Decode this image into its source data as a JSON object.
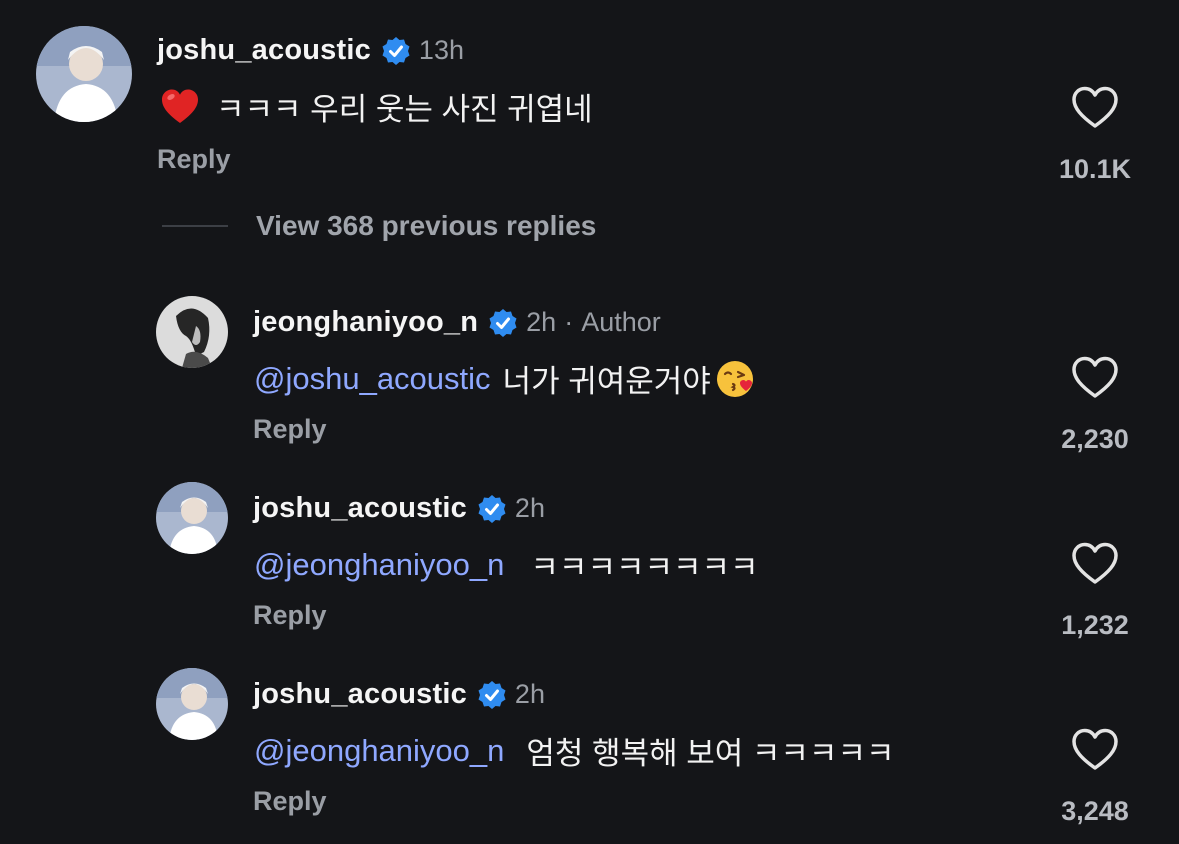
{
  "comment": {
    "username": "joshu_acoustic",
    "time": "13h",
    "text": "ㅋㅋㅋ 우리 웃는 사진 귀엽네",
    "reply_label": "Reply",
    "likes": "10.1K",
    "emoji": "red-heart"
  },
  "view_replies": {
    "label": "View 368 previous replies"
  },
  "replies": [
    {
      "username": "jeonghaniyoo_n",
      "time": "2h",
      "separator": "·",
      "badge": "Author",
      "mention": "@joshu_acoustic",
      "text": "너가 귀여운거야",
      "emoji": "kissing-heart",
      "reply_label": "Reply",
      "likes": "2,230"
    },
    {
      "username": "joshu_acoustic",
      "time": "2h",
      "mention": "@jeonghaniyoo_n",
      "text": "ㅋㅋㅋㅋㅋㅋㅋㅋ",
      "reply_label": "Reply",
      "likes": "1,232"
    },
    {
      "username": "joshu_acoustic",
      "time": "2h",
      "mention": "@jeonghaniyoo_n",
      "text": "엄청 행복해 보여 ㅋㅋㅋㅋㅋ",
      "reply_label": "Reply",
      "likes": "3,248"
    }
  ],
  "colors": {
    "background": "#141518",
    "mention": "#8fa8ff",
    "verified": "#2f8cf0",
    "muted": "#9a9ea5"
  }
}
